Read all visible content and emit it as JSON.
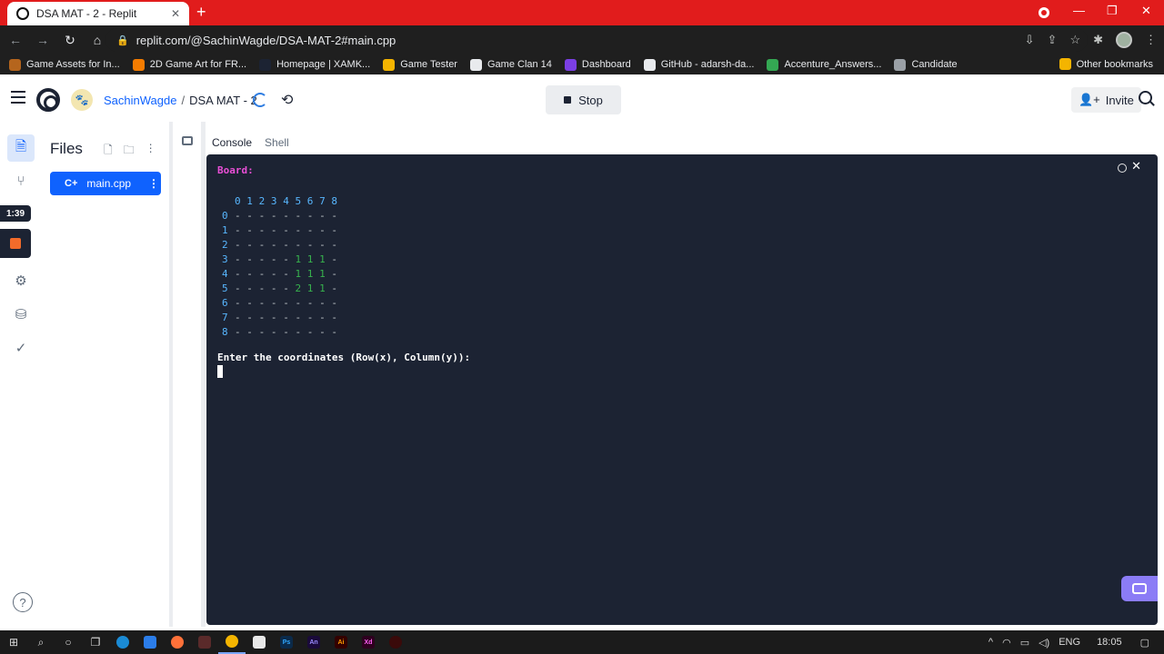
{
  "browser": {
    "tab_title": "DSA MAT - 2 - Replit",
    "url": "replit.com/@SachinWagde/DSA-MAT-2#main.cpp",
    "bookmarks": [
      {
        "label": "Game Assets for In...",
        "color": "#b5651d"
      },
      {
        "label": "2D Game Art for FR...",
        "color": "#f57c00"
      },
      {
        "label": "Homepage | XAMK...",
        "color": "#1c2333"
      },
      {
        "label": "Game Tester",
        "color": "#f4b400"
      },
      {
        "label": "Game Clan 14",
        "color": "#e8eaed"
      },
      {
        "label": "Dashboard",
        "color": "#7b3fe4"
      },
      {
        "label": "GitHub - adarsh-da...",
        "color": "#e8eaed"
      },
      {
        "label": "Accenture_Answers...",
        "color": "#34a853"
      },
      {
        "label": "Candidate",
        "color": "#9aa0a6"
      }
    ],
    "other_bookmarks": "Other bookmarks"
  },
  "header": {
    "username": "SachinWagde",
    "separator": "/",
    "repl_name": "DSA MAT - 2",
    "stop_label": "Stop",
    "invite_label": "Invite"
  },
  "rail": {
    "timer": "1:39"
  },
  "files": {
    "title": "Files",
    "items": [
      {
        "name": "main.cpp"
      }
    ]
  },
  "panel": {
    "tabs": [
      {
        "label": "Console"
      },
      {
        "label": "Shell"
      }
    ]
  },
  "console": {
    "label": "Board:",
    "column_headers": [
      "0",
      "1",
      "2",
      "3",
      "4",
      "5",
      "6",
      "7",
      "8"
    ],
    "rows": [
      {
        "label": "0",
        "cells": [
          "-",
          "-",
          "-",
          "-",
          "-",
          "-",
          "-",
          "-",
          "-"
        ]
      },
      {
        "label": "1",
        "cells": [
          "-",
          "-",
          "-",
          "-",
          "-",
          "-",
          "-",
          "-",
          "-"
        ]
      },
      {
        "label": "2",
        "cells": [
          "-",
          "-",
          "-",
          "-",
          "-",
          "-",
          "-",
          "-",
          "-"
        ]
      },
      {
        "label": "3",
        "cells": [
          "-",
          "-",
          "-",
          "-",
          "-",
          "1",
          "1",
          "1",
          "-"
        ]
      },
      {
        "label": "4",
        "cells": [
          "-",
          "-",
          "-",
          "-",
          "-",
          "1",
          "1",
          "1",
          "-"
        ]
      },
      {
        "label": "5",
        "cells": [
          "-",
          "-",
          "-",
          "-",
          "-",
          "2",
          "1",
          "1",
          "-"
        ]
      },
      {
        "label": "6",
        "cells": [
          "-",
          "-",
          "-",
          "-",
          "-",
          "-",
          "-",
          "-",
          "-"
        ]
      },
      {
        "label": "7",
        "cells": [
          "-",
          "-",
          "-",
          "-",
          "-",
          "-",
          "-",
          "-",
          "-"
        ]
      },
      {
        "label": "8",
        "cells": [
          "-",
          "-",
          "-",
          "-",
          "-",
          "-",
          "-",
          "-",
          "-"
        ]
      }
    ],
    "prompt": "Enter the coordinates (Row(x), Column(y)):"
  },
  "taskbar": {
    "language": "ENG",
    "time": "18:05"
  },
  "colors": {
    "chrome_red": "#e11c1c",
    "console_bg": "#1c2333",
    "accent_blue": "#0f62fe",
    "board_header": "#58b7ff",
    "board_number": "#37b24d",
    "label_magenta": "#e94fd6"
  }
}
